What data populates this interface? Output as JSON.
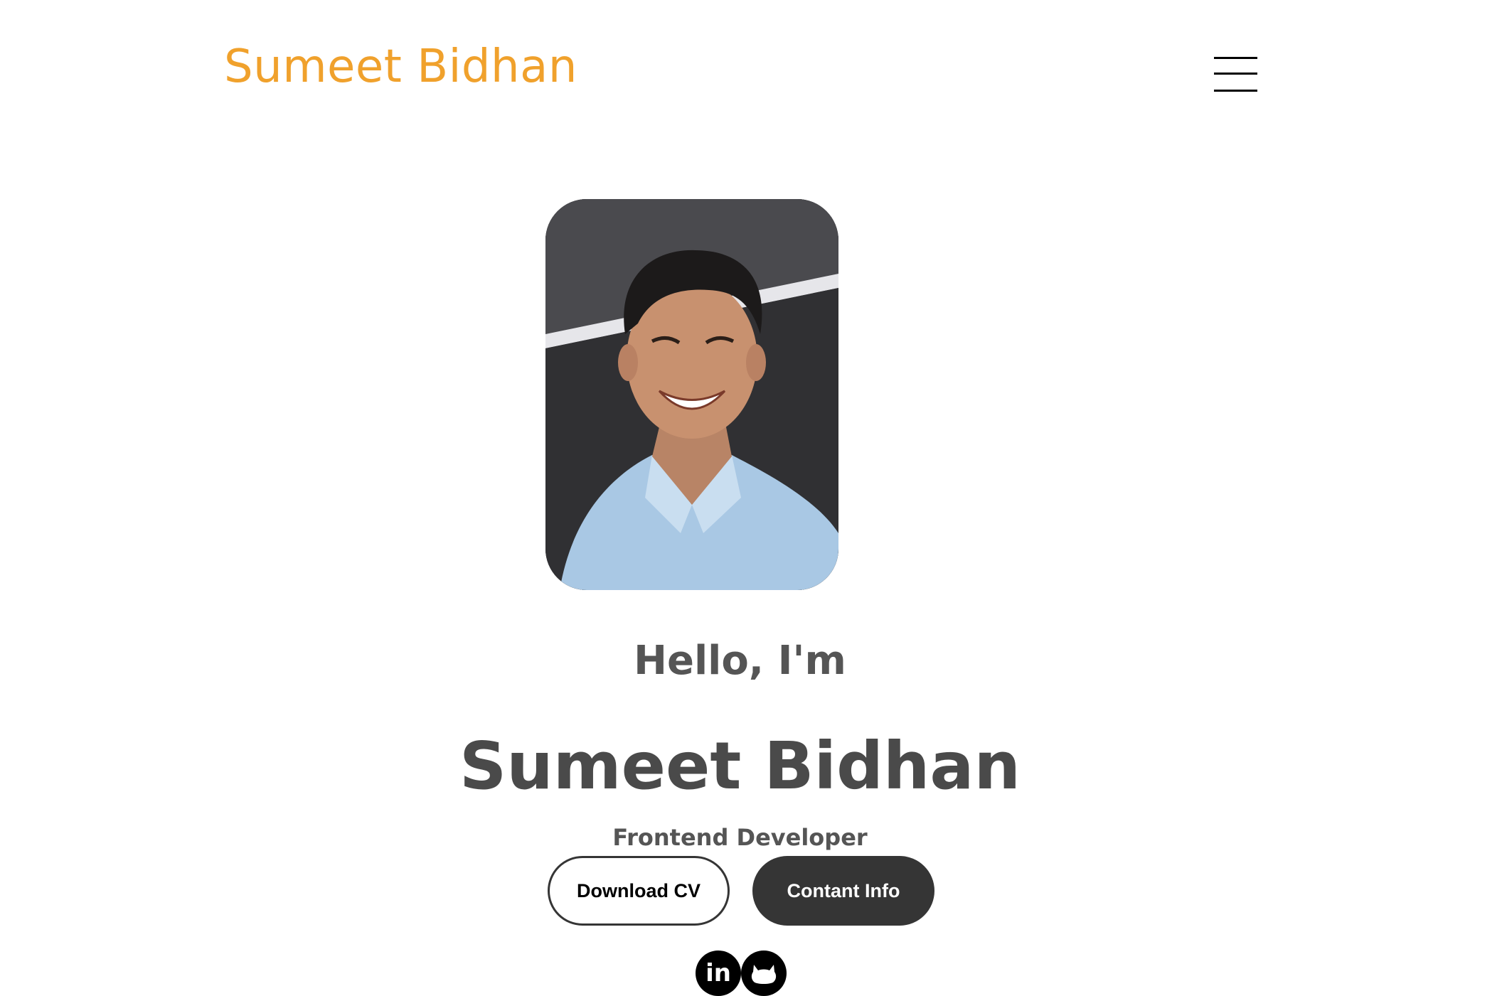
{
  "header": {
    "logo_text": "Sumeet Bidhan",
    "menu_icon": "hamburger-menu-icon"
  },
  "hero": {
    "profile_photo": "profile-photo",
    "greeting": "Hello, I'm",
    "name": "Sumeet Bidhan",
    "role": "Frontend Developer",
    "buttons": {
      "download_cv": "Download CV",
      "contact_info": "Contant Info"
    },
    "socials": [
      {
        "icon": "linkedin-icon",
        "label": "in"
      },
      {
        "icon": "github-icon"
      }
    ]
  },
  "colors": {
    "brand": "#f0a12c",
    "text_dark": "#555555",
    "button_dark": "#353535"
  }
}
